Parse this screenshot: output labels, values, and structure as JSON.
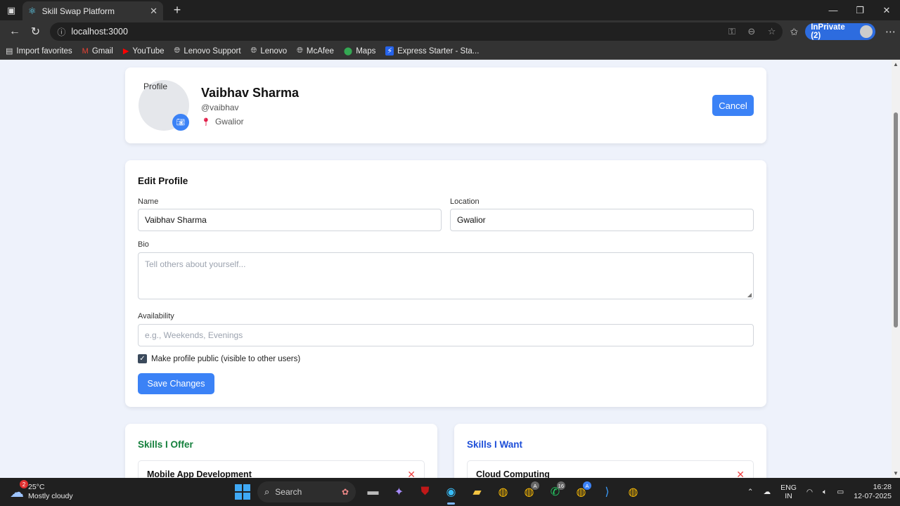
{
  "browser": {
    "tab_title": "Skill Swap Platform",
    "url": "localhost:3000",
    "inprivate_label": "InPrivate (2)",
    "bookmarks": [
      "Import favorites",
      "Gmail",
      "YouTube",
      "Lenovo Support",
      "Lenovo",
      "McAfee",
      "Maps",
      "Express Starter - Sta..."
    ]
  },
  "profile": {
    "avatar_alt": "Profile",
    "name": "Vaibhav Sharma",
    "handle": "@vaibhav",
    "location": "Gwalior",
    "cancel_label": "Cancel"
  },
  "edit_form": {
    "title": "Edit Profile",
    "name_label": "Name",
    "name_value": "Vaibhav Sharma",
    "location_label": "Location",
    "location_value": "Gwalior",
    "bio_label": "Bio",
    "bio_placeholder": "Tell others about yourself...",
    "availability_label": "Availability",
    "availability_placeholder": "e.g., Weekends, Evenings",
    "public_checkbox_label": "Make profile public (visible to other users)",
    "public_checked": true,
    "save_label": "Save Changes"
  },
  "skills_offer": {
    "title": "Skills I Offer",
    "color": "#15803d",
    "items": [
      "Mobile App Development"
    ]
  },
  "skills_want": {
    "title": "Skills I Want",
    "color": "#1d4ed8",
    "items": [
      "Cloud Computing"
    ]
  },
  "taskbar": {
    "weather_temp": "25°C",
    "weather_desc": "Mostly cloudy",
    "weather_badge": "2",
    "search_label": "Search",
    "chrome_profile_badge": "A",
    "whatsapp_badge": "16",
    "lang_top": "ENG",
    "lang_bottom": "IN",
    "time": "16:28",
    "date": "12-07-2025"
  }
}
